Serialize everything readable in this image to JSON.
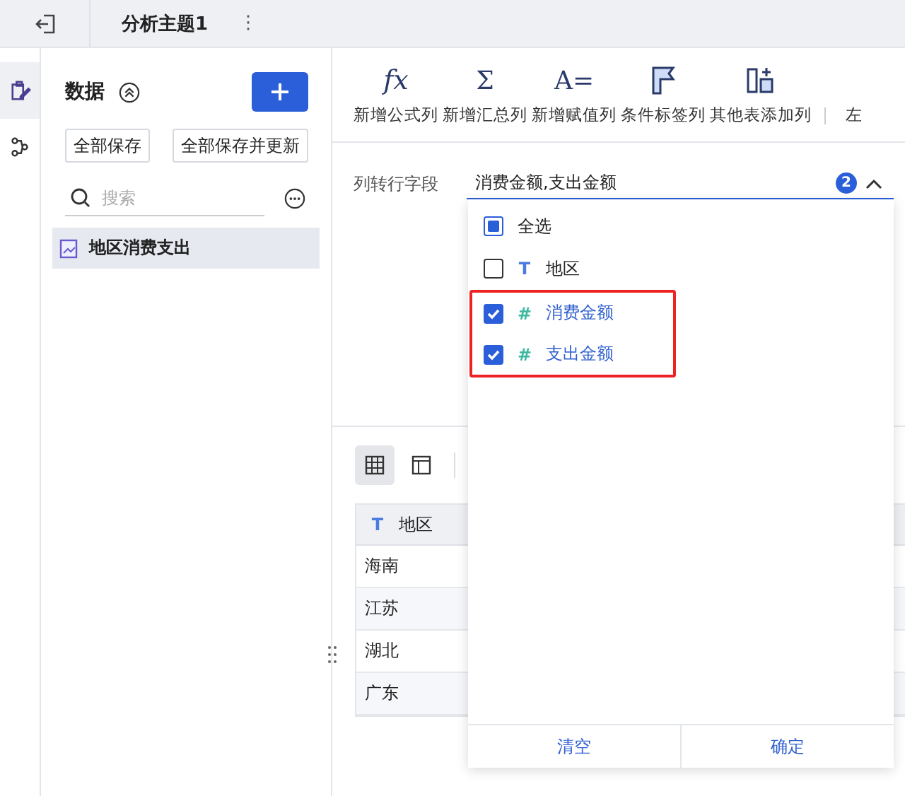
{
  "header": {
    "title": "分析主题1",
    "more": "⋮"
  },
  "rail": [
    {
      "kind": "edit",
      "selected": true
    },
    {
      "kind": "flow",
      "selected": false
    }
  ],
  "data_panel": {
    "title": "数据",
    "buttons": [
      "全部保存",
      "全部保存并更新"
    ],
    "search": {
      "placeholder": "搜索"
    },
    "items": [
      {
        "label": "地区消费支出",
        "selected": true
      }
    ]
  },
  "toolbar": [
    {
      "label": "新增公式列",
      "kind": "glyph",
      "glyph": "fx"
    },
    {
      "label": "新增汇总列",
      "kind": "glyph",
      "glyph": "Σ"
    },
    {
      "label": "新增赋值列",
      "kind": "glyph",
      "glyph": "A="
    },
    {
      "label": "条件标签列",
      "kind": "flag"
    },
    {
      "label": "其他表添加列",
      "kind": "table-add"
    },
    {
      "label": "左",
      "kind": "cut"
    }
  ],
  "field": {
    "label": "列转行字段",
    "value": "消费金额,支出金额",
    "count": "2",
    "expanded": true
  },
  "dropdown": {
    "options": [
      {
        "label": "全选",
        "kind": "all",
        "checked": false,
        "indeterminate": true,
        "highlighted": false
      },
      {
        "label": "地区",
        "kind": "field",
        "color": "#4a7be0",
        "type_glyph": "T",
        "checked": false,
        "highlighted": false
      },
      {
        "label": "消费金额",
        "kind": "field",
        "color": "#3bb8a0",
        "type_glyph": "#",
        "checked": true,
        "highlighted": true
      },
      {
        "label": "支出金额",
        "kind": "field",
        "color": "#3bb8a0",
        "type_glyph": "#",
        "checked": true,
        "highlighted": true
      }
    ],
    "buttons": [
      "清空",
      "确定"
    ]
  },
  "views": [
    {
      "kind": "grid",
      "selected": true
    },
    {
      "kind": "layout",
      "selected": false
    }
  ],
  "table": {
    "columns": [
      {
        "label": "地区",
        "type_glyph": "T"
      }
    ],
    "rows": [
      [
        "海南"
      ],
      [
        "江苏"
      ],
      [
        "湖北"
      ],
      [
        "广东"
      ]
    ]
  }
}
